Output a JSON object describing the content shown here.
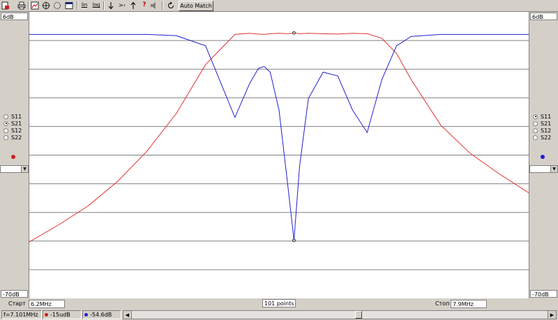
{
  "toolbar": {
    "icons": [
      "open-red-icon",
      "print-icon",
      "chart-icon",
      "crosshair-icon",
      "circle-icon",
      "window-icon",
      "lin-icon",
      "log-icon",
      "arrow-down-icon",
      "arrow-in-icon",
      "arrow-up-icon",
      "help-query-icon",
      "speaker-icon",
      "refresh-icon"
    ],
    "lin_label": "lin",
    "log_label": "log",
    "narrow_label": ">‹",
    "help_label": "?",
    "auto_match_label": "Auto Match"
  },
  "left_panel": {
    "top_scale": "6dB",
    "bottom_scale": "-70dB",
    "options": [
      "S11",
      "S21",
      "S12",
      "S22"
    ],
    "selected": "S21",
    "marker_color": "#cc2020"
  },
  "right_panel": {
    "top_scale": "6dB",
    "bottom_scale": "-70dB",
    "options": [
      "S11",
      "S21",
      "S12",
      "S22"
    ],
    "selected": "S11",
    "marker_color": "#2020cc"
  },
  "sweep": {
    "start_label": "Старт",
    "start_value": "6.2MHz",
    "points_value": "101 points",
    "stop_label": "Стоп",
    "stop_value": "7.9MHz"
  },
  "status": {
    "frequency": "f=7.101MHz",
    "red_value": "-15udB",
    "blue_value": "-54.6dB"
  },
  "chart_data": {
    "type": "line",
    "x": [
      6.2,
      6.3,
      6.4,
      6.5,
      6.6,
      6.7,
      6.8,
      6.9,
      6.95,
      6.98,
      7.0,
      7.02,
      7.05,
      7.08,
      7.101,
      7.12,
      7.15,
      7.2,
      7.25,
      7.3,
      7.35,
      7.4,
      7.45,
      7.5,
      7.6,
      7.7,
      7.8,
      7.9
    ],
    "ylim": [
      -70,
      6
    ],
    "series": [
      {
        "color": "#e03030",
        "values": [
          -55,
          -50.5,
          -45.5,
          -39,
          -31,
          -21,
          -8,
          0,
          0.3,
          0.1,
          0,
          0.2,
          0.3,
          0.2,
          0.4,
          0.2,
          0.3,
          0.2,
          0.1,
          0.3,
          0.2,
          -1,
          -5,
          -12,
          -24,
          -31.5,
          -37,
          -42
        ]
      },
      {
        "color": "#2020d0",
        "values": [
          0,
          0,
          0,
          0,
          0,
          -0.3,
          -3,
          -22,
          -13,
          -9,
          -8.5,
          -10,
          -20,
          -40,
          -54.6,
          -35,
          -17,
          -10,
          -11,
          -20,
          -26,
          -12,
          -3,
          -0.5,
          0,
          0,
          0,
          0
        ]
      }
    ],
    "markers": [
      {
        "series": 0,
        "x": 7.101
      },
      {
        "series": 1,
        "x": 7.101
      }
    ],
    "grid": true
  }
}
